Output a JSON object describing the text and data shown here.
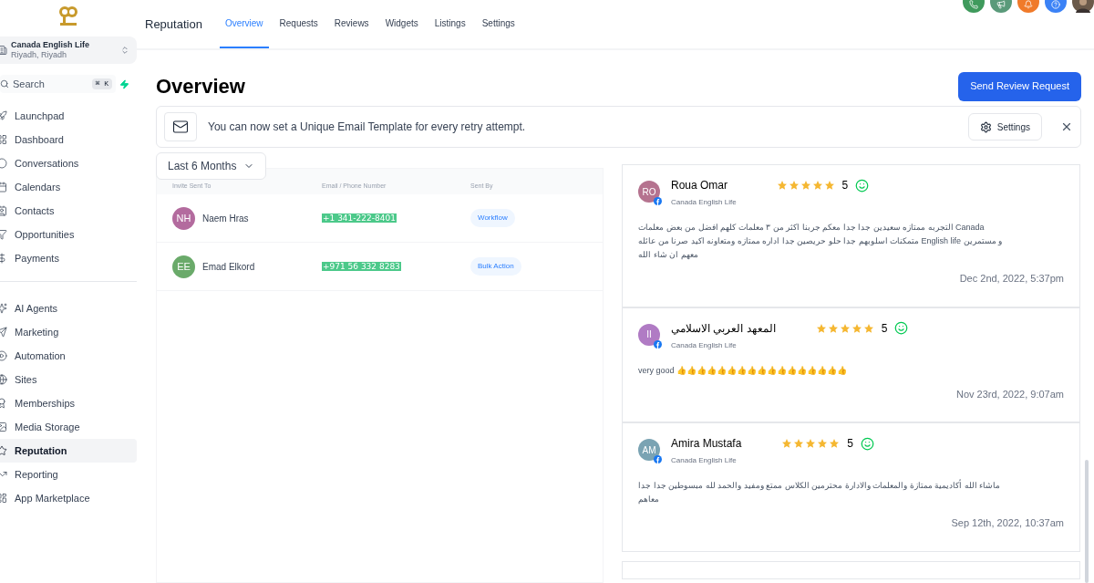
{
  "account": {
    "name": "Canada English Life",
    "location": "Riyadh, Riyadh"
  },
  "search": {
    "placeholder": "Search",
    "shortcut": "⌘ K"
  },
  "sidebar": {
    "groups": [
      [
        {
          "label": "Launchpad",
          "kind": "rocket",
          "selected": false
        },
        {
          "label": "Dashboard",
          "kind": "grid",
          "selected": false
        },
        {
          "label": "Conversations",
          "kind": "chat",
          "selected": false
        },
        {
          "label": "Calendars",
          "kind": "calendar",
          "selected": false
        },
        {
          "label": "Contacts",
          "kind": "contact",
          "selected": false
        },
        {
          "label": "Opportunities",
          "kind": "funnel",
          "selected": false
        },
        {
          "label": "Payments",
          "kind": "dollar",
          "selected": false
        }
      ],
      [
        {
          "label": "AI Agents",
          "kind": "sparkle",
          "selected": false
        },
        {
          "label": "Marketing",
          "kind": "send",
          "selected": false
        },
        {
          "label": "Automation",
          "kind": "play",
          "selected": false
        },
        {
          "label": "Sites",
          "kind": "globe",
          "selected": false
        },
        {
          "label": "Memberships",
          "kind": "award",
          "selected": false
        },
        {
          "label": "Media Storage",
          "kind": "image",
          "selected": false
        },
        {
          "label": "Reputation",
          "kind": "star",
          "selected": true
        },
        {
          "label": "Reporting",
          "kind": "trend",
          "selected": false
        },
        {
          "label": "App Marketplace",
          "kind": "apps",
          "selected": false
        }
      ]
    ]
  },
  "header": {
    "title": "Reputation",
    "tabs": [
      {
        "label": "Overview",
        "selected": true
      },
      {
        "label": "Requests",
        "selected": false
      },
      {
        "label": "Reviews",
        "selected": false
      },
      {
        "label": "Widgets",
        "selected": false
      },
      {
        "label": "Listings",
        "selected": false
      },
      {
        "label": "Settings",
        "selected": false
      }
    ],
    "actions": [
      {
        "kind": "phone",
        "color": "#3f9a5c"
      },
      {
        "kind": "megaphone",
        "color": "#5a9a7a"
      },
      {
        "kind": "bell",
        "color": "#f07a2a"
      },
      {
        "kind": "help",
        "color": "#3b82f6"
      }
    ]
  },
  "page": {
    "title": "Overview",
    "primary_button": "Send Review Request"
  },
  "banner": {
    "text": "You can now set a Unique Email Template for every retry attempt.",
    "button": "Settings"
  },
  "filter": {
    "value": "Last 6 Months"
  },
  "requests": {
    "columns": [
      "Invite Sent To",
      "Email / Phone Number",
      "Sent By"
    ],
    "rows": [
      {
        "initials": "NH",
        "color": "#b36b9e",
        "name": "Naem Hras",
        "phone": "+1 341-222-8401",
        "sent_by": "Workflow"
      },
      {
        "initials": "EE",
        "color": "#6aaa6a",
        "name": "Emad Elkord",
        "phone": "+971 56 332 8283",
        "sent_by": "Bulk Action"
      }
    ]
  },
  "reviews": [
    {
      "initials": "RO",
      "color": "#b5738f",
      "name": "Roua Omar",
      "location": "Canada English Life",
      "stars": 5,
      "rating": "5",
      "text": "التجربه ممتازه سعيدين جدا جدا معكم جربنا اكثر من ٣ معلمات كلهم افضل من بعض معلمات Canada متمكنات اسلوبهم جدا حلو حريصين جدا اداره ممتازه ومتعاونه اكيد صرنا من عائله English life و مستمرين معهم ان شاء الله",
      "date": "Dec 2nd, 2022, 5:37pm"
    },
    {
      "initials": "II",
      "color": "#b07bc4",
      "name": "المعهد العربي الاسلامي",
      "location": "Canada English Life",
      "stars": 5,
      "rating": "5",
      "text": "very good 👍👍👍👍👍👍👍👍👍👍👍👍👍👍👍👍👍",
      "date": "Nov 23rd, 2022, 9:07am"
    },
    {
      "initials": "AM",
      "color": "#7aa3b3",
      "name": "Amira Mustafa",
      "location": "Canada English Life",
      "stars": 5,
      "rating": "5",
      "text": "ماشاء الله أكاديمية ممتازة والمعلمات والادارة محترمين الكلاس ممتع ومفيد والحمد لله مبسوطين جدا جدا معاهم",
      "date": "Sep 12th, 2022, 10:37am"
    }
  ]
}
